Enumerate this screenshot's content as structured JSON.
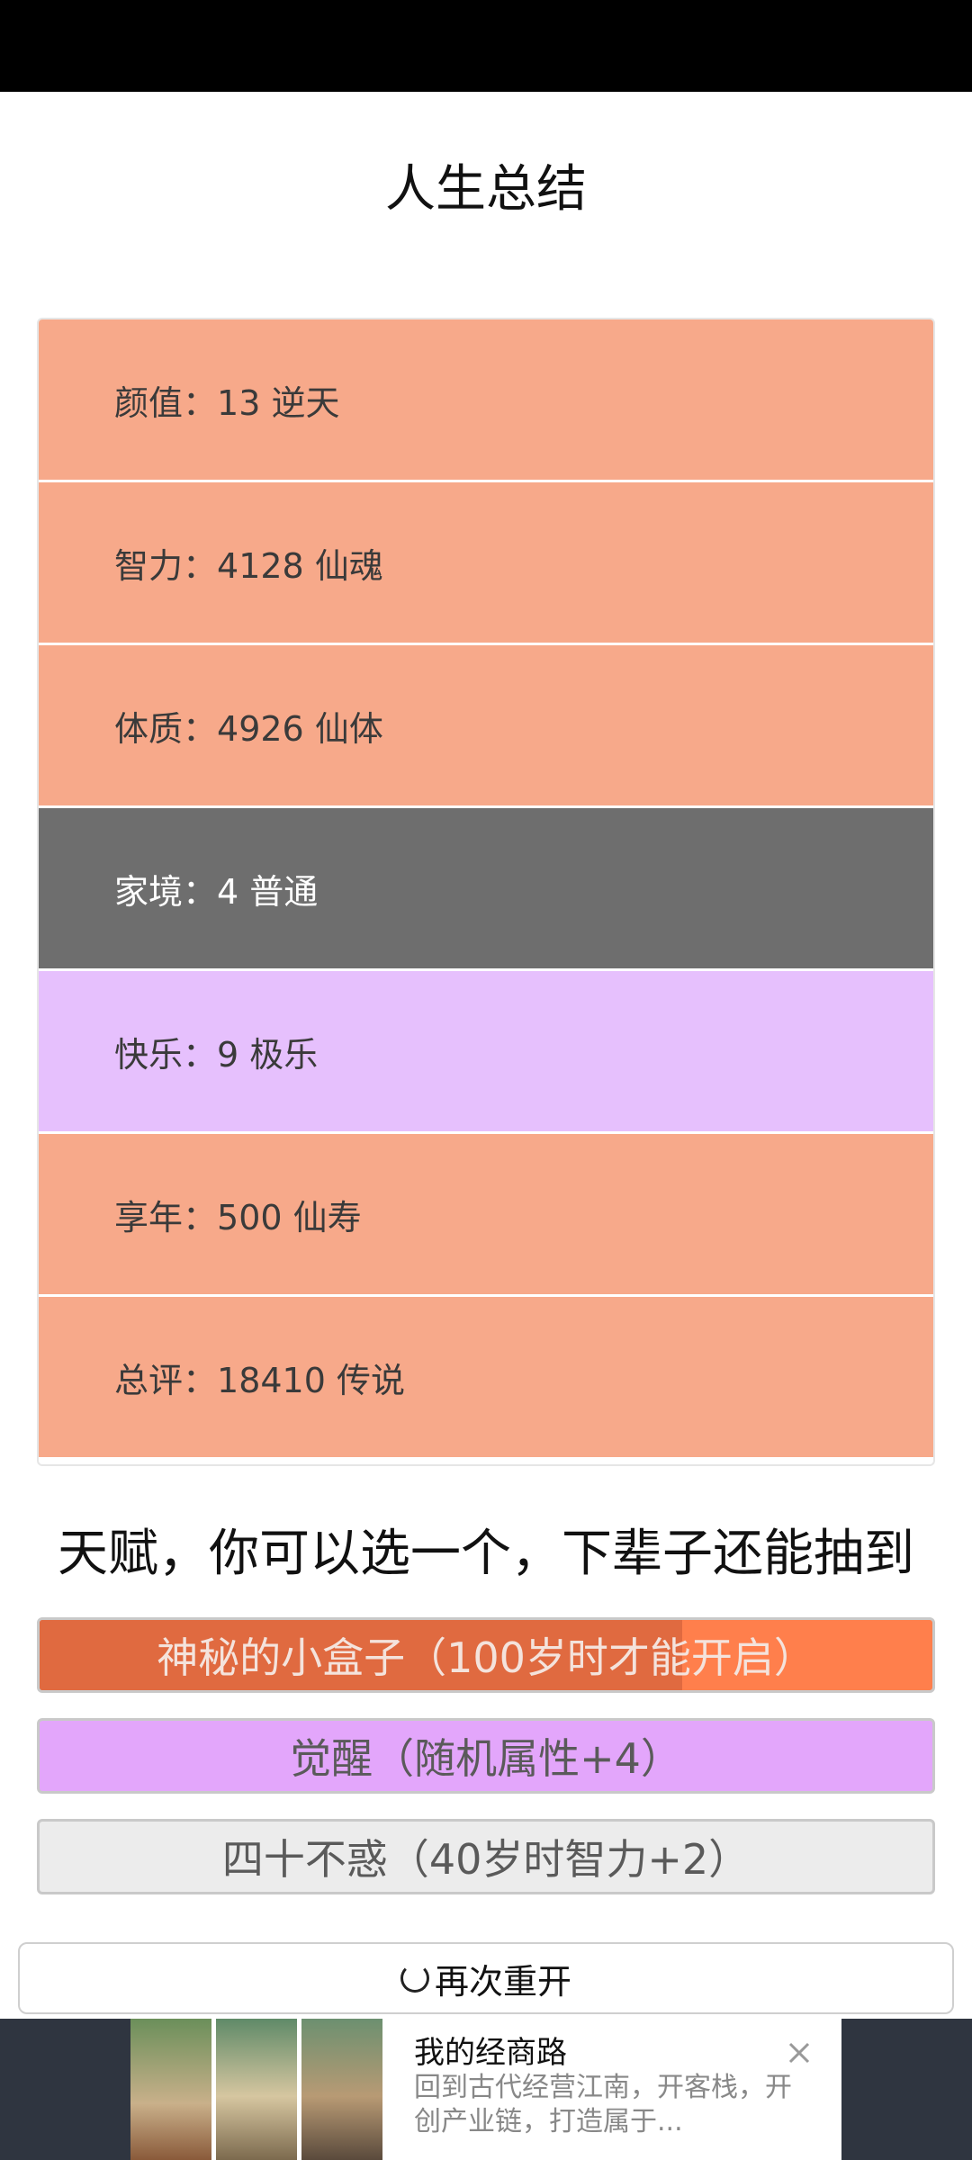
{
  "title": "人生总结",
  "stats": [
    {
      "label": "颜值",
      "value": "13 逆天",
      "color": "#f7a98a",
      "text_color": "#3a3a3a"
    },
    {
      "label": "智力",
      "value": "4128 仙魂",
      "color": "#f7a98a",
      "text_color": "#3a3a3a"
    },
    {
      "label": "体质",
      "value": "4926 仙体",
      "color": "#f7a98a",
      "text_color": "#3a3a3a"
    },
    {
      "label": "家境",
      "value": "4 普通",
      "color": "#6e6e6e",
      "text_color": "#ffffff"
    },
    {
      "label": "快乐",
      "value": "9 极乐",
      "color": "#e6c0fd",
      "text_color": "#3a3a3a"
    },
    {
      "label": "享年",
      "value": "500 仙寿",
      "color": "#f7a98a",
      "text_color": "#3a3a3a"
    },
    {
      "label": "总评",
      "value": "18410 传说",
      "color": "#f7a98a",
      "text_color": "#3a3a3a"
    }
  ],
  "stat_separator": "：",
  "talent_heading": "天赋，你可以选一个，下辈子还能抽到",
  "talents": [
    {
      "label": "神秘的小盒子（100岁时才能开启）",
      "color": "#ff7f4c",
      "fill_color": "#e06a40",
      "progress": 0.72,
      "text_color": "#f4e3dc"
    },
    {
      "label": "觉醒（随机属性+4）",
      "color": "#e3a6fb",
      "text_color": "#5a5a5a"
    },
    {
      "label": "四十不惑（40岁时智力+2）",
      "color": "#ececec",
      "text_color": "#5a5a5a"
    }
  ],
  "restart_label": "再次重开",
  "ad": {
    "app_name": "我的经商路",
    "description": "回到古代经营江南，开客栈，开创产业链，打造属于...",
    "close_icon": "close-icon"
  }
}
